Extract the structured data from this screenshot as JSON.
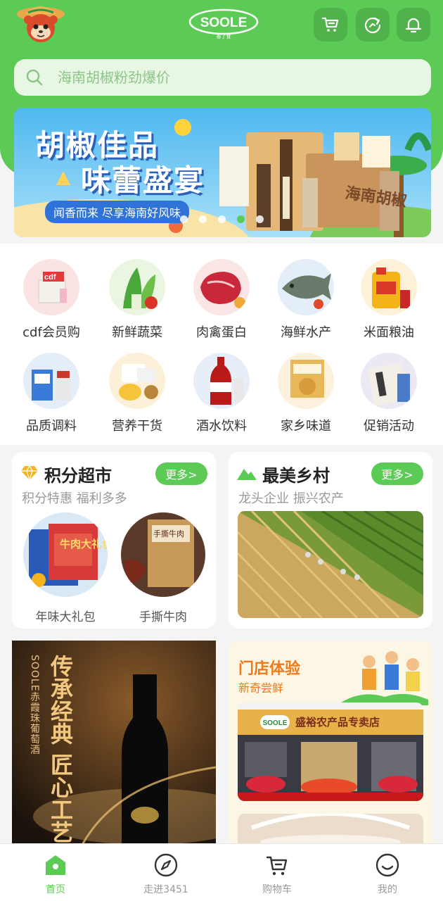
{
  "header": {
    "logo_text": "SOOLE",
    "logo_sub": "善了食",
    "icons": [
      "cart-icon",
      "refresh-icon",
      "bell-icon"
    ]
  },
  "search": {
    "placeholder": "海南胡椒粉劲爆价"
  },
  "banner": {
    "title_line1": "胡椒佳品",
    "title_line2": "味蕾盛宴",
    "subtitle": "闻香而来 尽享海南好风味",
    "box_text": "海南胡椒",
    "active_dot": 3,
    "dot_count": 5
  },
  "categories": [
    {
      "label": "cdf会员购",
      "icon": "cdf-member-icon"
    },
    {
      "label": "新鲜蔬菜",
      "icon": "vegetable-icon"
    },
    {
      "label": "肉禽蛋白",
      "icon": "meat-icon"
    },
    {
      "label": "海鲜水产",
      "icon": "seafood-icon"
    },
    {
      "label": "米面粮油",
      "icon": "oil-grain-icon"
    },
    {
      "label": "品质调料",
      "icon": "seasoning-icon"
    },
    {
      "label": "营养干货",
      "icon": "dried-goods-icon"
    },
    {
      "label": "酒水饮料",
      "icon": "drinks-icon"
    },
    {
      "label": "家乡味道",
      "icon": "hometown-icon"
    },
    {
      "label": "促销活动",
      "icon": "promotion-icon"
    }
  ],
  "points_market": {
    "title": "积分超市",
    "subtitle": "积分特惠 福利多多",
    "more": "更多>",
    "products": [
      {
        "label": "年味大礼包",
        "package_text": "牛肉大礼包"
      },
      {
        "label": "手撕牛肉",
        "package_text": "手撕牛肉"
      }
    ]
  },
  "village": {
    "title": "最美乡村",
    "subtitle": "龙头企业  振兴农产",
    "more": "更多>"
  },
  "wine_promo": {
    "headline_1": "传承经典",
    "headline_2": "匠心工艺",
    "vertical_text": "SOOLE赤霞珠葡萄酒"
  },
  "store": {
    "title": "门店体验",
    "subtitle": "新奇尝鲜",
    "sign_logo": "SOOLE",
    "sign_text": "盛裕农产品专卖店"
  },
  "tabbar": [
    {
      "label": "首页",
      "icon": "home-icon",
      "active": true
    },
    {
      "label": "走进3451",
      "icon": "compass-icon",
      "active": false
    },
    {
      "label": "购物车",
      "icon": "cart-icon",
      "active": false
    },
    {
      "label": "我的",
      "icon": "profile-icon",
      "active": false
    }
  ],
  "colors": {
    "brand_green": "#5ccb56",
    "search_bg": "#e8f6e4",
    "banner_blue": "#2f72d8"
  }
}
